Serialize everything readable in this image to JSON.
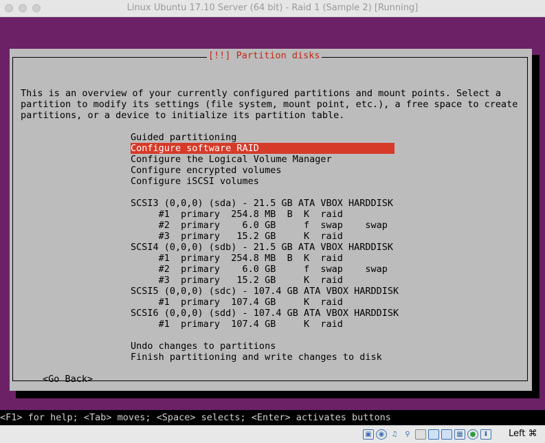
{
  "window": {
    "title": "Linux Ubuntu 17.10 Server (64 bit) - Raid 1 (Sample 2) [Running]"
  },
  "dialog": {
    "title": "[!!] Partition disks",
    "intro": [
      "This is an overview of your currently configured partitions and mount points. Select a",
      "partition to modify its settings (file system, mount point, etc.), a free space to create",
      "partitions, or a device to initialize its partition table."
    ],
    "menu": [
      "Guided partitioning",
      "Configure software RAID",
      "Configure the Logical Volume Manager",
      "Configure encrypted volumes",
      "Configure iSCSI volumes"
    ],
    "selected_index": 1,
    "devices": [
      "SCSI3 (0,0,0) (sda) - 21.5 GB ATA VBOX HARDDISK",
      "     #1  primary  254.8 MB  B  K  raid",
      "     #2  primary    6.0 GB     f  swap    swap",
      "     #3  primary   15.2 GB     K  raid",
      "SCSI4 (0,0,0) (sdb) - 21.5 GB ATA VBOX HARDDISK",
      "     #1  primary  254.8 MB  B  K  raid",
      "     #2  primary    6.0 GB     f  swap    swap",
      "     #3  primary   15.2 GB     K  raid",
      "SCSI5 (0,0,0) (sdc) - 107.4 GB ATA VBOX HARDDISK",
      "     #1  primary  107.4 GB     K  raid",
      "SCSI6 (0,0,0) (sdd) - 107.4 GB ATA VBOX HARDDISK",
      "     #1  primary  107.4 GB     K  raid"
    ],
    "actions": [
      "Undo changes to partitions",
      "Finish partitioning and write changes to disk"
    ],
    "go_back": "<Go Back>"
  },
  "status_bar": "<F1> for help; <Tab> moves; <Space> selects; <Enter> activates buttons",
  "host_key": "Left ⌘",
  "colors": {
    "background": "#6c2167",
    "dialog": "#bcbcbc",
    "highlight": "#d63a28",
    "title": "#c0281c"
  }
}
